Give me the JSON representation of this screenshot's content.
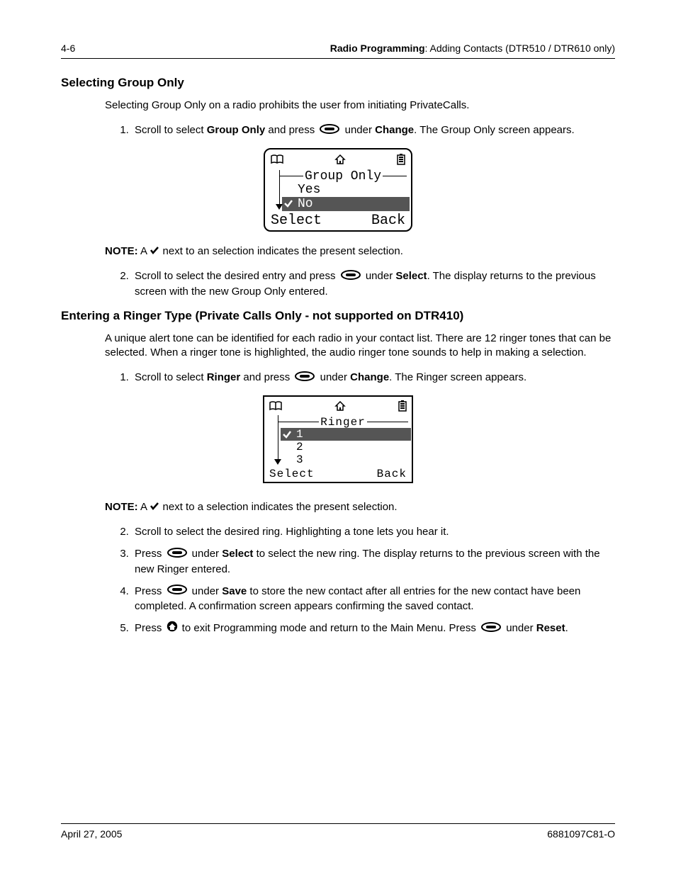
{
  "header": {
    "page_num": "4-6",
    "section_bold": "Radio Programming",
    "section_rest": ": Adding Contacts (DTR510 / DTR610 only)"
  },
  "section1": {
    "title": "Selecting Group Only",
    "intro": "Selecting Group Only on a radio prohibits the user from initiating PrivateCalls.",
    "step1_a": "Scroll to select ",
    "step1_b": "Group Only",
    "step1_c": " and press ",
    "step1_d": " under ",
    "step1_e": "Change",
    "step1_f": ". The Group Only screen appears.",
    "note_a": "NOTE:",
    "note_b": "  A ",
    "note_c": " next to an selection indicates the present selection.",
    "step2_a": "Scroll to select the desired entry and press ",
    "step2_b": " under ",
    "step2_c": "Select",
    "step2_d": ". The display returns to the previous screen with the new Group Only entered."
  },
  "lcd1": {
    "title": "Group Only",
    "opt1": "Yes",
    "opt2": "No",
    "soft_left": "Select",
    "soft_right": "Back"
  },
  "section2": {
    "title": "Entering a Ringer Type (Private Calls Only - not supported on DTR410)",
    "intro": "A unique alert tone can be identified for each radio in your contact list. There are 12 ringer tones that can be selected. When a ringer tone is highlighted, the audio ringer tone sounds to help in making a selection.",
    "step1_a": "Scroll to select ",
    "step1_b": "Ringer",
    "step1_c": " and press ",
    "step1_d": " under ",
    "step1_e": "Change",
    "step1_f": ". The Ringer screen appears.",
    "note_a": "NOTE:",
    "note_b": "  A ",
    "note_c": " next to a selection indicates the present selection.",
    "step2": "Scroll to select the desired ring. Highlighting a tone lets you hear it.",
    "step3_a": "Press ",
    "step3_b": " under ",
    "step3_c": "Select",
    "step3_d": " to select the new ring. The display returns to the previous screen with the new Ringer entered.",
    "step4_a": "Press ",
    "step4_b": " under ",
    "step4_c": "Save",
    "step4_d": " to store the new contact after all entries for the new contact have been completed. A confirmation screen appears confirming the saved contact.",
    "step5_a": "Press ",
    "step5_b": " to exit Programming mode and return to the Main Menu. Press ",
    "step5_c": " under ",
    "step5_d": "Reset",
    "step5_e": "."
  },
  "lcd2": {
    "title": "Ringer",
    "opt1": "1",
    "opt2": "2",
    "opt3": "3",
    "soft_left": "Select",
    "soft_right": "Back"
  },
  "footer": {
    "date": "April 27, 2005",
    "docnum": "6881097C81-O"
  }
}
